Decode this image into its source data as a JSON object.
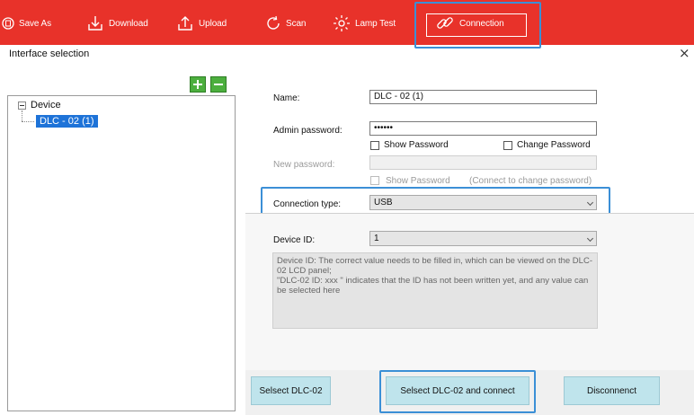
{
  "toolbar": {
    "items": [
      {
        "label": "Save As",
        "icon": "save-icon"
      },
      {
        "label": "Download",
        "icon": "download-icon"
      },
      {
        "label": "Upload",
        "icon": "upload-icon"
      },
      {
        "label": "Scan",
        "icon": "scan-icon"
      },
      {
        "label": "Lamp Test",
        "icon": "lamp-icon"
      },
      {
        "label": "Connection",
        "icon": "link-icon"
      }
    ]
  },
  "dialog": {
    "title": "Interface selection",
    "close_label": "×"
  },
  "tree": {
    "root": "Device",
    "child": "DLC - 02 (1)"
  },
  "form": {
    "name_label": "Name:",
    "name_value": "DLC - 02 (1)",
    "admin_label": "Admin password:",
    "admin_value": "••••••",
    "show_password_label": "Show Password",
    "change_password_label": "Change Password",
    "new_password_label": "New password:",
    "new_show_password_label": "Show Password",
    "connect_hint": "(Connect to change password)",
    "connection_type_label": "Connection type:",
    "connection_type_value": "USB",
    "device_id_label": "Device ID:",
    "device_id_value": "1",
    "desc_line1": "Device ID: The correct value needs to be filled in, which can be viewed on the DLC-02 LCD panel;",
    "desc_line2": "\"DLC-02 ID: xxx \" indicates that the ID has not been written yet, and any value can be selected here"
  },
  "buttons": {
    "select": "Selsect DLC-02",
    "select_connect": "Selsect DLC-02 and connect",
    "disconnect": "Disconnenct"
  },
  "colors": {
    "toolbar_bg": "#e8322a",
    "highlight": "#3b8fd6",
    "selection": "#1e73d8",
    "button_bg": "#bfe4ec",
    "add_green": "#4caf3e"
  }
}
